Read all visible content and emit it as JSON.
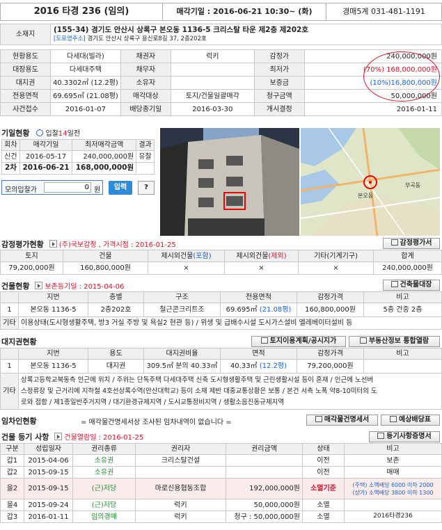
{
  "header": {
    "case": "2016 타경 236 (임의)",
    "date": "매각기일 : 2016-06-21 10:30~ (화)",
    "court": "경매5계 031-481-1191"
  },
  "location": {
    "label": "소재지",
    "address": "(155-34) 경기도 안산시 상록구 본오동 1136-5 크리스탈 타운 제2층 제202호",
    "road_tag": "[도로명주소]",
    "road": "경기도 안산시 상록구 용신로8길 37, 2층202호"
  },
  "info_rows": [
    [
      "현황용도",
      "다세대(빌라)",
      "채권자",
      "럭키",
      "감정가",
      "240,000,000원"
    ],
    [
      "대장용도",
      "다세대주택",
      "채무자",
      "",
      "최저가",
      "(70%) 168,000,000원"
    ],
    [
      "대지권",
      "40.3302㎡ (12.2평)",
      "소유자",
      "",
      "보증금",
      "(10%)16,800,000원"
    ],
    [
      "전용면적",
      "69.695㎡ (21.08평)",
      "매각대상",
      "토지/건물일괄매각",
      "청구금액",
      "50,000,000원"
    ],
    [
      "사건접수",
      "2016-01-07",
      "배당종기일",
      "2016-03-30",
      "개시결정",
      "2016-01-11"
    ]
  ],
  "bids": {
    "title": "기일현황",
    "toggle_pre": "입찰",
    "toggle_num": "14",
    "toggle_post": "일전",
    "headers": [
      "회차",
      "매각기일",
      "최저매각금액",
      "결과"
    ],
    "rows": [
      [
        "신건",
        "2016-05-17",
        "240,000,000원",
        "유찰"
      ],
      [
        "2차",
        "2016-06-21",
        "168,000,000원",
        ""
      ]
    ],
    "mock_label": "모의입찰가",
    "mock_value": "0",
    "mock_unit": "원",
    "input_btn": "입력",
    "help": "?"
  },
  "map": {
    "label1": "본오동",
    "label2": "부곡동"
  },
  "appraisal": {
    "title": "감정평가현황",
    "note": "(주)국보감정 , 가격시점 : 2016-01-25",
    "button": "감정평가서",
    "headers": [
      "토지",
      "건물",
      "제시외건물(포함)",
      "제시외건물(제외)",
      "기타(기계기구)",
      "합계"
    ],
    "h_parts": {
      "inc_a": "제시외건물",
      "inc_b": "(포함)",
      "exc_a": "제시외건물",
      "exc_b": "(제외)"
    },
    "values": [
      "79,200,000원",
      "160,800,000원",
      "×",
      "×",
      "×",
      "240,000,000원"
    ]
  },
  "building": {
    "title": "건물현황",
    "note": "보존등기일 : 2015-04-06",
    "button": "건축물대장",
    "headers": [
      "",
      "지번",
      "층별",
      "구조",
      "전용면적",
      "감정가격",
      "비고"
    ],
    "row": [
      "1",
      "본오동 1136-5",
      "2층202호",
      "철근콘크리트조",
      "69.695㎡",
      "(21.08평)",
      "160,800,000원",
      "5층 건중 2층"
    ],
    "etc_label": "기타",
    "etc": "이용상태(도시형생활주택, 방3 거실 주방 및 욕실2 현관 등) / 위생 및 급배수시설 도시가스설비 엘레베이터설비 등"
  },
  "land": {
    "title": "대지권현황",
    "btn1": "토지이용계획/공시지가",
    "btn2": "부동산정보 통합열람",
    "headers": [
      "",
      "지번",
      "용도",
      "대지권비율",
      "면적",
      "감정가격",
      "비고"
    ],
    "row": [
      "1",
      "본오동 1136-5",
      "대지권",
      "309.5㎡ 분의 40.33㎡",
      "40.33㎡",
      "(12.2평)",
      "79,200,000원"
    ],
    "etc_label": "기타",
    "etc1": "상록고등학교북동측 인근에 위치 / 주위는 단독주택 다세대주택 신축 도시형생활주택 및 근린생활시설 등이 혼재 / 인근에 노선버",
    "etc2": "스정류장 및 근거리에 지하철 4호선상록수역(안산대학교) 등이 소재 제반 대중교통상황은 보통 / 본건 서측 노폭 약8-10미터의 도",
    "etc3": "로와 접함 / 제1종일반주거지역 / 대기환경규제지역 / 도시교통정비지역 / 생활소음진동규제지역"
  },
  "tenant": {
    "title": "임차인현황",
    "text": "= 매각물건명세서상 조사된 임차내역이 없습니다 =",
    "btn1": "매각물건명세서",
    "btn2": "예상배당표"
  },
  "registry": {
    "title": "건물 등기 사항",
    "note": "건물열람일 : 2016-01-25",
    "button": "등기사항증명서",
    "headers": [
      "구분",
      "성립일자",
      "권리종류",
      "권리자",
      "권리금액",
      "상태",
      "비고"
    ],
    "rows": [
      [
        "갑1",
        "2015-04-06",
        "소유권",
        "크리스탈건설",
        "",
        "이전",
        "보존"
      ],
      [
        "갑2",
        "2015-09-15",
        "소유권",
        "",
        "",
        "이전",
        "매매"
      ],
      [
        "을2",
        "2015-09-15",
        "(근)저당",
        "마로신용협동조합",
        "192,000,000원",
        "소멸기준",
        "(주택) 소액배당 6000 이하 2000",
        "(상가) 소액배당 3800 이하 1300"
      ],
      [
        "을4",
        "2015-09-24",
        "(근)저당",
        "럭키",
        "50,000,000원",
        "소멸",
        "",
        ""
      ],
      [
        "갑3",
        "2016-01-11",
        "임의경매",
        "럭키",
        "청구 : 50,000,000원",
        "소멸",
        "2016타경236",
        ""
      ]
    ]
  }
}
